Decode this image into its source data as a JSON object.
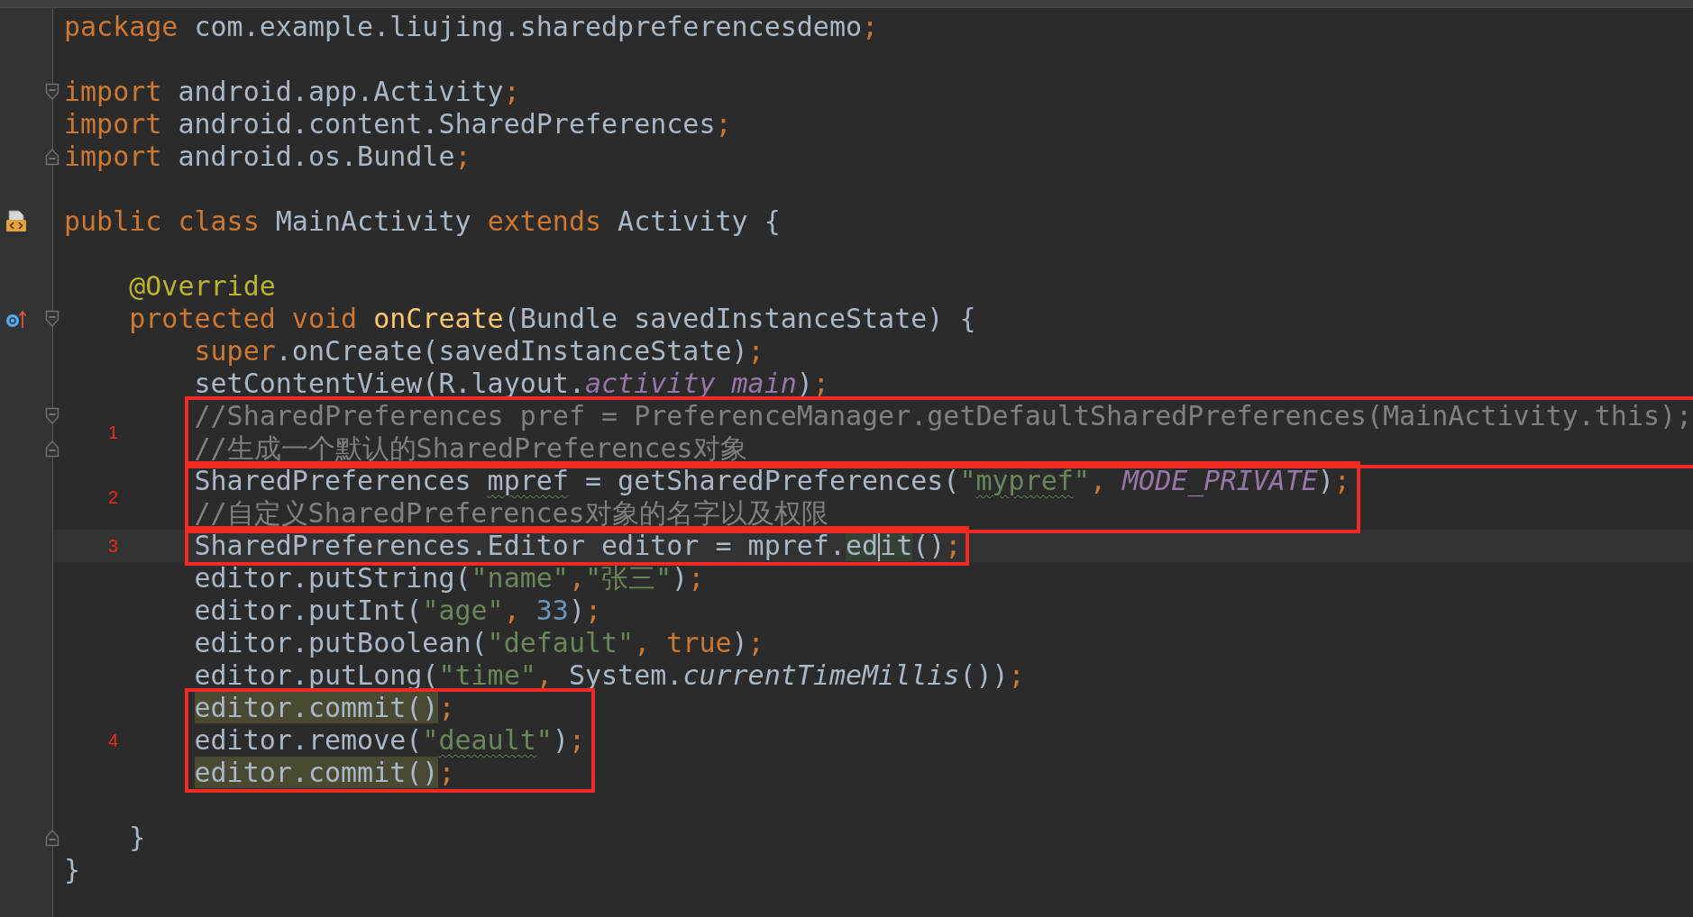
{
  "editor": {
    "lines": [
      {
        "kind": "code",
        "segments": [
          {
            "kind": "keyword",
            "text": "package"
          },
          {
            "kind": "plain",
            "text": " com.example.liujing.sharedpreferencesdemo"
          },
          {
            "kind": "keyword",
            "text": ";"
          }
        ]
      },
      {
        "kind": "blank"
      },
      {
        "kind": "code",
        "fold_start": true,
        "segments": [
          {
            "kind": "keyword",
            "text": "import"
          },
          {
            "kind": "plain",
            "text": " android.app.Activity"
          },
          {
            "kind": "keyword",
            "text": ";"
          }
        ]
      },
      {
        "kind": "code",
        "segments": [
          {
            "kind": "keyword",
            "text": "import"
          },
          {
            "kind": "plain",
            "text": " android.content.SharedPreferences"
          },
          {
            "kind": "keyword",
            "text": ";"
          }
        ]
      },
      {
        "kind": "code",
        "fold_end": true,
        "segments": [
          {
            "kind": "keyword",
            "text": "import"
          },
          {
            "kind": "plain",
            "text": " android.os.Bundle"
          },
          {
            "kind": "keyword",
            "text": ";"
          }
        ]
      },
      {
        "kind": "blank"
      },
      {
        "kind": "code",
        "class_marker": true,
        "segments": [
          {
            "kind": "keyword",
            "text": "public class"
          },
          {
            "kind": "plain",
            "text": " MainActivity "
          },
          {
            "kind": "keyword",
            "text": "extends"
          },
          {
            "kind": "plain",
            "text": " Activity {"
          }
        ]
      },
      {
        "kind": "blank"
      },
      {
        "kind": "code",
        "segments": [
          {
            "kind": "annotation",
            "text": "    @Override"
          }
        ]
      },
      {
        "kind": "code",
        "override_marker": true,
        "fold_start": true,
        "segments": [
          {
            "kind": "keyword",
            "text": "    protected void "
          },
          {
            "kind": "method",
            "text": "onCreate"
          },
          {
            "kind": "plain",
            "text": "(Bundle savedInstanceState) {"
          }
        ]
      },
      {
        "kind": "code",
        "segments": [
          {
            "kind": "keyword",
            "text": "        super"
          },
          {
            "kind": "plain",
            "text": ".onCreate(savedInstanceState)"
          },
          {
            "kind": "keyword",
            "text": ";"
          }
        ]
      },
      {
        "kind": "code",
        "segments": [
          {
            "kind": "plain",
            "text": "        setContentView(R.layout."
          },
          {
            "kind": "field",
            "text": "activity_main"
          },
          {
            "kind": "plain",
            "text": ")"
          },
          {
            "kind": "keyword",
            "text": ";"
          }
        ]
      },
      {
        "kind": "code",
        "fold_start": true,
        "frame": "1",
        "segments": [
          {
            "kind": "comment",
            "text": "        //SharedPreferences pref = PreferenceManager.getDefaultSharedPreferences(MainActivity.this);"
          }
        ]
      },
      {
        "kind": "code",
        "fold_end": true,
        "framed": true,
        "segments": [
          {
            "kind": "comment",
            "text": "        //生成一个默认的SharedPreferences对象"
          }
        ]
      },
      {
        "kind": "code",
        "frame": "2",
        "segments": [
          {
            "kind": "plain",
            "text": "        SharedPreferences "
          },
          {
            "kind": "plain",
            "text": "mpref",
            "typo": true
          },
          {
            "kind": "plain",
            "text": " = getSharedPreferences("
          },
          {
            "kind": "string",
            "text": "\""
          },
          {
            "kind": "string",
            "text": "mypref",
            "typo": true
          },
          {
            "kind": "string",
            "text": "\""
          },
          {
            "kind": "keyword",
            "text": ", "
          },
          {
            "kind": "field",
            "text": "MODE_PRIVATE"
          },
          {
            "kind": "plain",
            "text": ")"
          },
          {
            "kind": "keyword",
            "text": ";"
          }
        ]
      },
      {
        "kind": "code",
        "framed": true,
        "segments": [
          {
            "kind": "comment",
            "text": "        //自定义SharedPreferences对象的名字以及权限"
          }
        ]
      },
      {
        "kind": "code",
        "frame": "3",
        "current": true,
        "segments": [
          {
            "kind": "plain",
            "text": "        SharedPreferences.Editor editor = mpref."
          },
          {
            "kind": "plain",
            "text": "ed",
            "match_highlight": true,
            "caret_after": true
          },
          {
            "kind": "plain",
            "text": "it",
            "match_highlight": true
          },
          {
            "kind": "plain",
            "text": "()"
          },
          {
            "kind": "keyword",
            "text": ";"
          }
        ]
      },
      {
        "kind": "code",
        "segments": [
          {
            "kind": "plain",
            "text": "        editor.putString("
          },
          {
            "kind": "string",
            "text": "\"name\""
          },
          {
            "kind": "keyword",
            "text": ","
          },
          {
            "kind": "string",
            "text": "\"张三\""
          },
          {
            "kind": "plain",
            "text": ")"
          },
          {
            "kind": "keyword",
            "text": ";"
          }
        ]
      },
      {
        "kind": "code",
        "segments": [
          {
            "kind": "plain",
            "text": "        editor.putInt("
          },
          {
            "kind": "string",
            "text": "\"age\""
          },
          {
            "kind": "keyword",
            "text": ", "
          },
          {
            "kind": "number",
            "text": "33"
          },
          {
            "kind": "plain",
            "text": ")"
          },
          {
            "kind": "keyword",
            "text": ";"
          }
        ]
      },
      {
        "kind": "code",
        "segments": [
          {
            "kind": "plain",
            "text": "        editor.putBoolean("
          },
          {
            "kind": "string",
            "text": "\"default\""
          },
          {
            "kind": "keyword",
            "text": ", true"
          },
          {
            "kind": "plain",
            "text": ")"
          },
          {
            "kind": "keyword",
            "text": ";"
          }
        ]
      },
      {
        "kind": "code",
        "segments": [
          {
            "kind": "plain",
            "text": "        editor.putLong("
          },
          {
            "kind": "string",
            "text": "\"time\""
          },
          {
            "kind": "keyword",
            "text": ", "
          },
          {
            "kind": "plain",
            "text": "System."
          },
          {
            "kind": "static",
            "text": "currentTimeMillis"
          },
          {
            "kind": "plain",
            "text": "())"
          },
          {
            "kind": "keyword",
            "text": ";"
          }
        ]
      },
      {
        "kind": "code",
        "frame": "4",
        "segments": [
          {
            "kind": "plain",
            "text": "        editor.commit()",
            "usage_highlight": true
          },
          {
            "kind": "keyword",
            "text": ";"
          }
        ]
      },
      {
        "kind": "code",
        "framed": true,
        "segments": [
          {
            "kind": "plain",
            "text": "        editor.remove("
          },
          {
            "kind": "string",
            "text": "\""
          },
          {
            "kind": "string",
            "text": "deault",
            "typo": true
          },
          {
            "kind": "string",
            "text": "\""
          },
          {
            "kind": "plain",
            "text": ")"
          },
          {
            "kind": "keyword",
            "text": ";"
          }
        ]
      },
      {
        "kind": "code",
        "framed": true,
        "segments": [
          {
            "kind": "plain",
            "text": "        editor.commit()",
            "usage_highlight": true
          },
          {
            "kind": "keyword",
            "text": ";"
          }
        ]
      },
      {
        "kind": "blank"
      },
      {
        "kind": "code",
        "fold_end": true,
        "segments": [
          {
            "kind": "plain",
            "text": "    }"
          }
        ]
      },
      {
        "kind": "code",
        "segments": [
          {
            "kind": "plain",
            "text": "}"
          }
        ]
      }
    ]
  }
}
